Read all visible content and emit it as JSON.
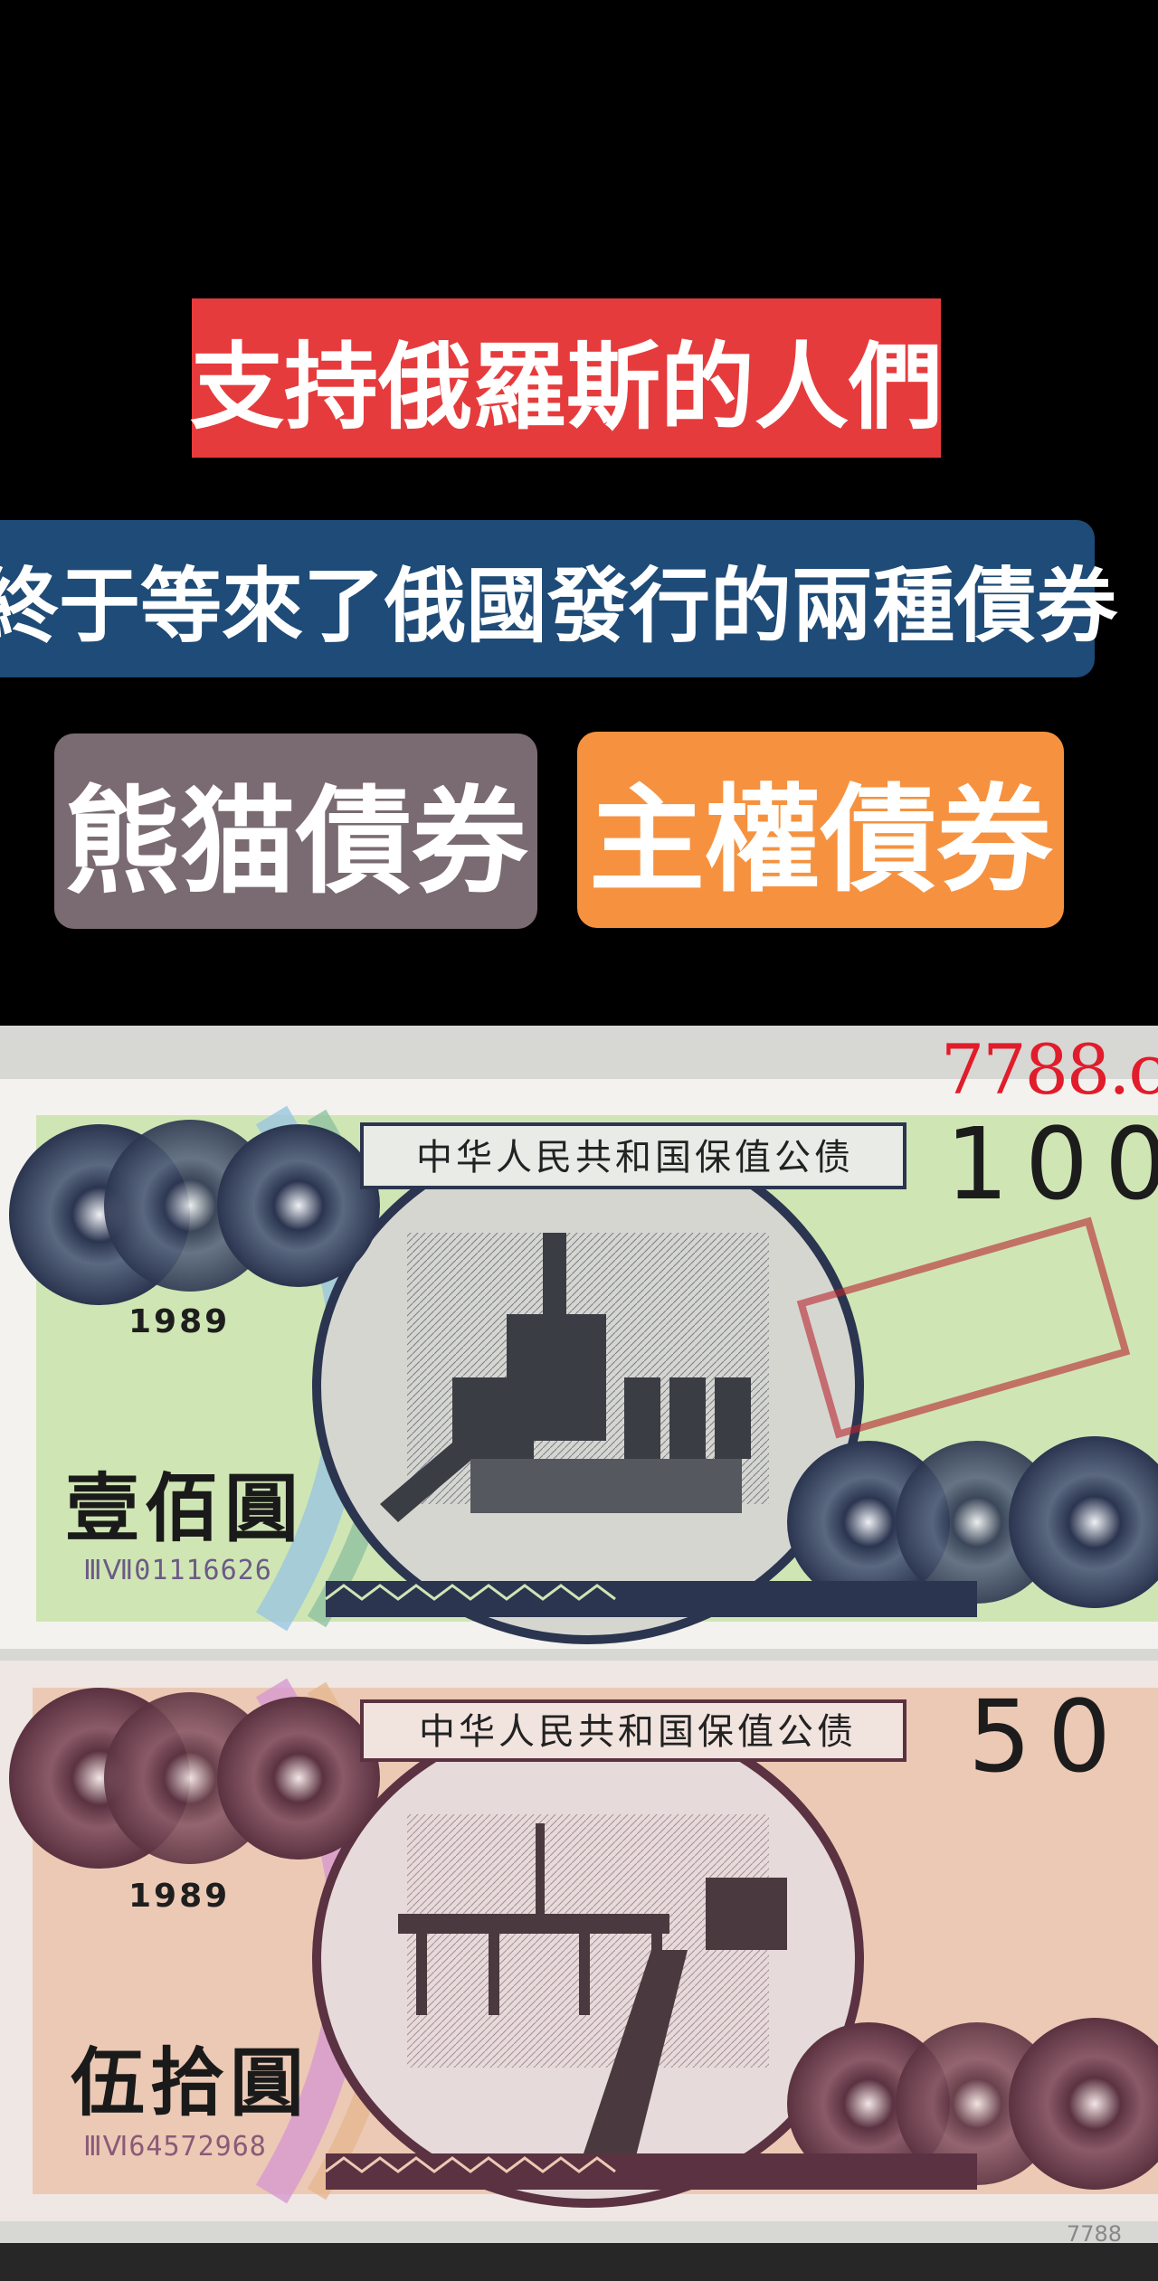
{
  "banners": {
    "title": "支持俄羅斯的人們",
    "subtitle": "終于等來了俄國發行的兩種債券",
    "tag_panda": "熊猫債券",
    "tag_sovereign": "主權債券"
  },
  "watermark": {
    "site": "7788.c",
    "corner": "7788"
  },
  "notes": [
    {
      "header": "中华人民共和国保值公债",
      "denomination": "100",
      "year": "1989",
      "amount_text": "壹佰圓",
      "serial": "ⅢⅦ01116626",
      "colors": {
        "base": "#cfe6b4",
        "accent": "#2b3550",
        "serial": "#6c5a86"
      }
    },
    {
      "header": "中华人民共和国保值公债",
      "denomination": "50",
      "year": "1989",
      "amount_text": "伍拾圓",
      "serial": "ⅢⅥ64572968",
      "colors": {
        "base": "#ecc9b4",
        "accent": "#5b3241",
        "serial": "#8a5a78"
      }
    }
  ]
}
